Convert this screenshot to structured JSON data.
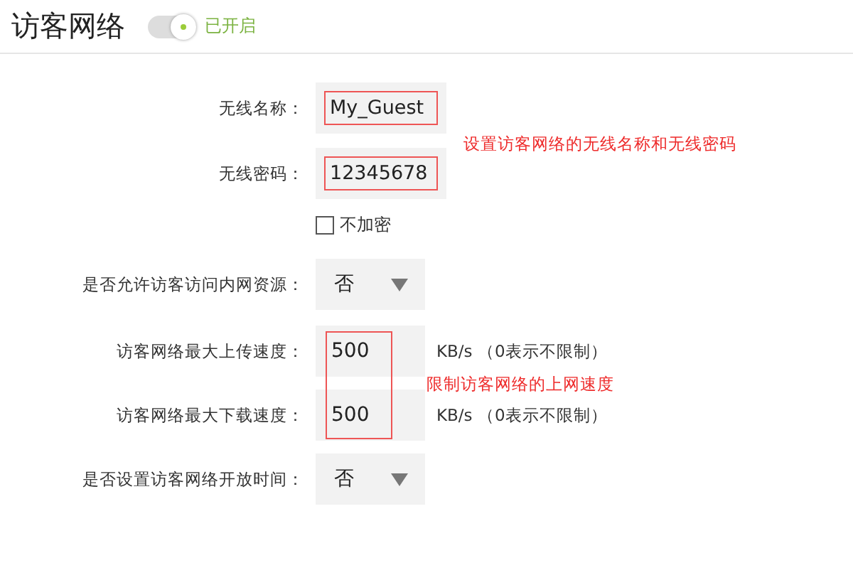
{
  "header": {
    "title": "访客网络",
    "toggle": {
      "on": true
    },
    "status": "已开启"
  },
  "rows": [
    {
      "kind": "text",
      "label": "无线名称：",
      "value": "My_Guest",
      "marked": true
    },
    {
      "kind": "text",
      "label": "无线密码：",
      "value": "12345678",
      "marked": true
    },
    {
      "kind": "checkbox",
      "label": "不加密",
      "checked": false
    },
    {
      "kind": "select",
      "label": "是否允许访客访问内网资源：",
      "value": "否"
    },
    {
      "kind": "speed",
      "label": "访客网络最大上传速度：",
      "value": "500",
      "unit": "KB/s （0表示不限制）",
      "marked": true
    },
    {
      "kind": "speed",
      "label": "访客网络最大下载速度：",
      "value": "500",
      "unit": "KB/s （0表示不限制）",
      "marked": true
    },
    {
      "kind": "select",
      "label": "是否设置访客网络开放时间：",
      "value": "否"
    }
  ],
  "notes": [
    "设置访客网络的无线名称和无线密码",
    "限制访客网络的上网速度"
  ]
}
